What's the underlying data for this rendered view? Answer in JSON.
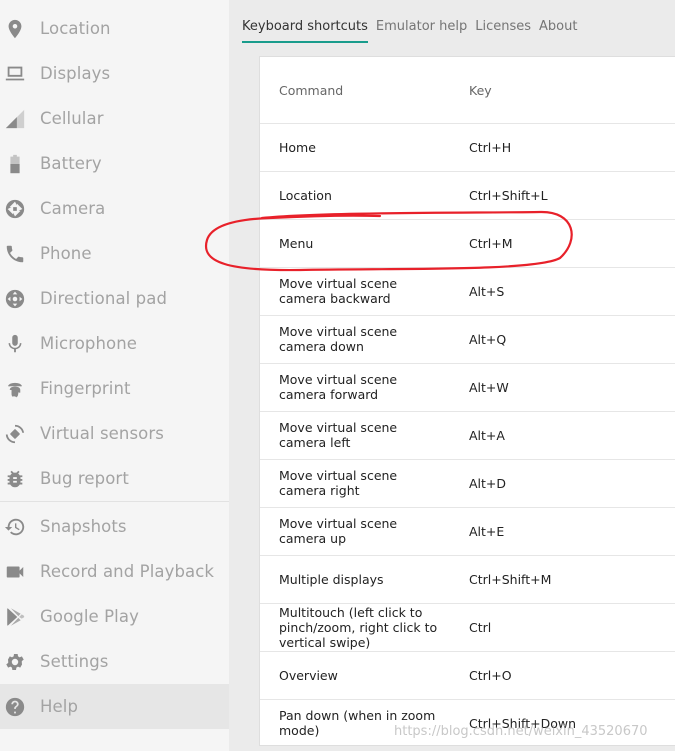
{
  "sidebar": {
    "items": [
      {
        "label": "Location",
        "icon": "location-pin-icon"
      },
      {
        "label": "Displays",
        "icon": "monitor-icon"
      },
      {
        "label": "Cellular",
        "icon": "cellular-signal-icon"
      },
      {
        "label": "Battery",
        "icon": "battery-icon"
      },
      {
        "label": "Camera",
        "icon": "camera-aperture-icon"
      },
      {
        "label": "Phone",
        "icon": "phone-icon"
      },
      {
        "label": "Directional pad",
        "icon": "dpad-icon"
      },
      {
        "label": "Microphone",
        "icon": "microphone-icon"
      },
      {
        "label": "Fingerprint",
        "icon": "fingerprint-icon"
      },
      {
        "label": "Virtual sensors",
        "icon": "rotation-icon"
      },
      {
        "label": "Bug report",
        "icon": "bug-icon"
      },
      {
        "label": "Snapshots",
        "icon": "history-icon"
      },
      {
        "label": "Record and Playback",
        "icon": "videocam-icon"
      },
      {
        "label": "Google Play",
        "icon": "play-store-icon"
      },
      {
        "label": "Settings",
        "icon": "gear-icon"
      },
      {
        "label": "Help",
        "icon": "help-icon",
        "selected": true
      }
    ]
  },
  "tabs": [
    {
      "label": "Keyboard shortcuts",
      "active": true
    },
    {
      "label": "Emulator help"
    },
    {
      "label": "Licenses"
    },
    {
      "label": "About"
    }
  ],
  "shortcuts": {
    "header": {
      "command": "Command",
      "key": "Key"
    },
    "rows": [
      {
        "command": "Home",
        "key": "Ctrl+H"
      },
      {
        "command": "Location",
        "key": "Ctrl+Shift+L"
      },
      {
        "command": "Menu",
        "key": "Ctrl+M"
      },
      {
        "command": "Move virtual scene camera backward",
        "key": "Alt+S"
      },
      {
        "command": "Move virtual scene camera down",
        "key": "Alt+Q"
      },
      {
        "command": "Move virtual scene camera forward",
        "key": "Alt+W"
      },
      {
        "command": "Move virtual scene camera left",
        "key": "Alt+A"
      },
      {
        "command": "Move virtual scene camera right",
        "key": "Alt+D"
      },
      {
        "command": "Move virtual scene camera up",
        "key": "Alt+E"
      },
      {
        "command": "Multiple displays",
        "key": "Ctrl+Shift+M"
      },
      {
        "command": "Multitouch (left click to pinch/zoom, right click to vertical swipe)",
        "key": "Ctrl"
      },
      {
        "command": "Overview",
        "key": "Ctrl+O"
      },
      {
        "command": "Pan down (when in zoom mode)",
        "key": "Ctrl+Shift+Down"
      }
    ]
  },
  "annotation": {
    "color": "#e8212a"
  },
  "watermark": "https://blog.csdn.net/weixin_43520670"
}
